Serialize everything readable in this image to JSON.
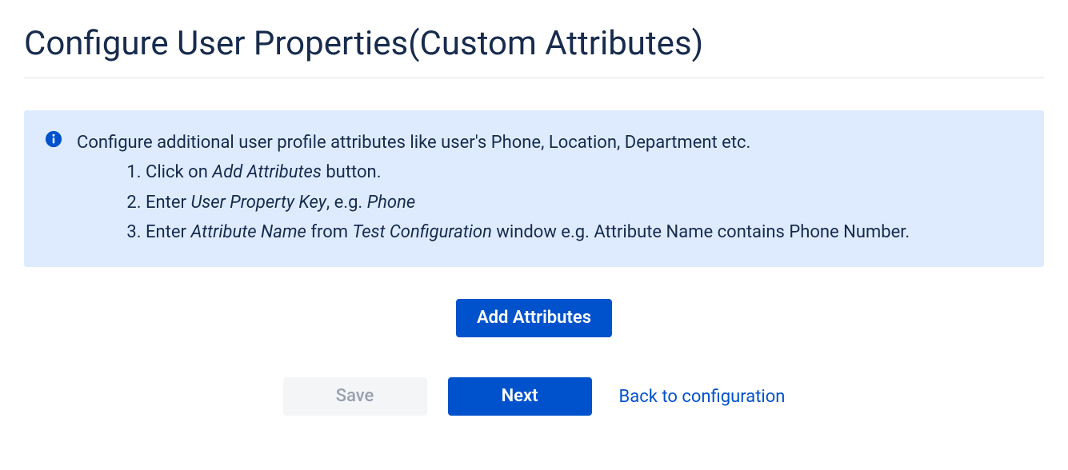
{
  "header": {
    "title": "Configure User Properties(Custom Attributes)"
  },
  "info": {
    "lead": "Configure additional user profile attributes like user's Phone, Location, Department etc.",
    "steps": [
      {
        "prefix": "Click on ",
        "em1": "Add Attributes",
        "mid": " button.",
        "em2": "",
        "suffix": ""
      },
      {
        "prefix": "Enter ",
        "em1": "User Property Key",
        "mid": ", e.g. ",
        "em2": "Phone",
        "suffix": ""
      },
      {
        "prefix": "Enter ",
        "em1": "Attribute Name",
        "mid": " from ",
        "em2": "Test Configuration",
        "suffix": " window e.g. Attribute Name contains Phone Number."
      }
    ]
  },
  "buttons": {
    "add_attributes": "Add Attributes",
    "save": "Save",
    "next": "Next",
    "back": "Back to configuration"
  }
}
